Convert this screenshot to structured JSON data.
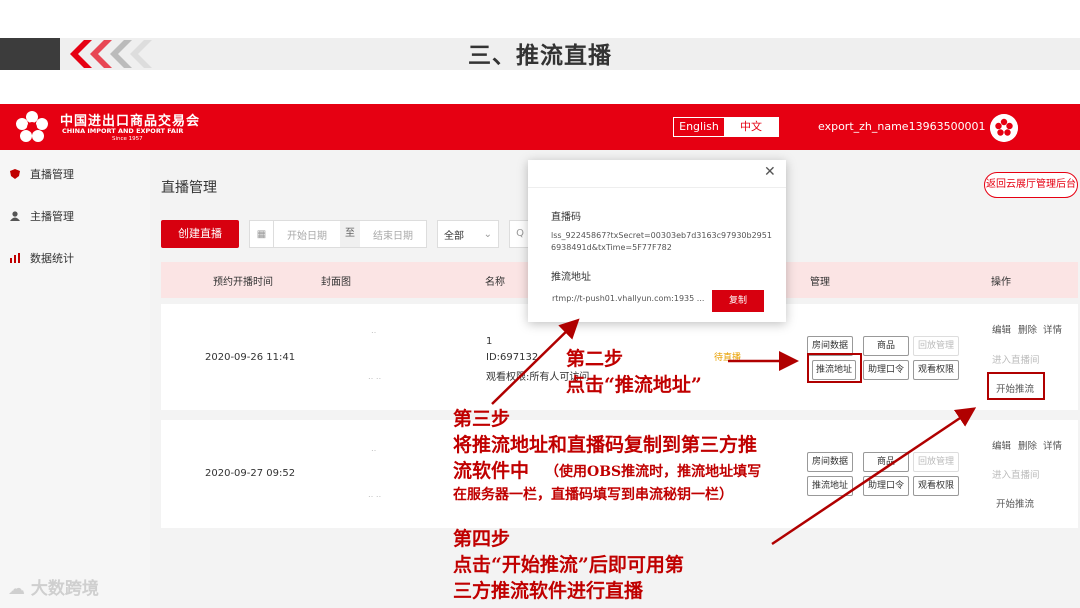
{
  "slide": {
    "title": "三、推流直播"
  },
  "header": {
    "logo_cn": "中国进出口商品交易会",
    "logo_en": "CHINA IMPORT AND EXPORT FAIR",
    "logo_since": "Since 1957",
    "lang_en": "English",
    "lang_zh": "中文",
    "username": "export_zh_name13963500001"
  },
  "sidebar": {
    "items": [
      {
        "label": "直播管理",
        "icon": "shield-icon"
      },
      {
        "label": "主播管理",
        "icon": "person-icon"
      },
      {
        "label": "数据统计",
        "icon": "bar-chart-icon"
      }
    ]
  },
  "main": {
    "heading": "直播管理",
    "back_button": "返回云展厅管理后台",
    "create_button": "创建直播",
    "start_date_placeholder": "开始日期",
    "range_to": "至",
    "end_date_placeholder": "结束日期",
    "filter_selected": "全部",
    "columns": [
      "预约开播时间",
      "封面图",
      "名称",
      "管理",
      "操作"
    ],
    "rows": [
      {
        "time": "2020-09-26 11:41",
        "name": "1",
        "id": "ID:697132",
        "permission": "观看权限:所有人可访问",
        "status": "待直播",
        "manage_buttons": [
          "房间数据",
          "商品",
          "回放管理",
          "推流地址",
          "助理口令",
          "观看权限"
        ],
        "ops": [
          "编辑",
          "删除",
          "详情",
          "进入直播间",
          "开始推流"
        ]
      },
      {
        "time": "2020-09-27 09:52",
        "manage_buttons": [
          "房间数据",
          "商品",
          "回放管理",
          "推流地址",
          "助理口令",
          "观看权限"
        ],
        "ops": [
          "编辑",
          "删除",
          "详情",
          "进入直播间",
          "开始推流"
        ]
      }
    ]
  },
  "modal": {
    "code_label": "直播码",
    "code_value": "lss_92245867?txSecret=00303eb7d3163c97930b29516938491d&txTime=5F77F782",
    "url_label": "推流地址",
    "url_value": "rtmp://t-push01.vhallyun.com:1935 ...",
    "copy_button": "复制"
  },
  "annotations": {
    "step2_title": "第二步",
    "step2_text": "点击“推流地址”",
    "step3_title": "第三步",
    "step3_line1": "将推流地址和直播码复制到第三方推",
    "step3_line2": "流软件中",
    "step3_line2_small": "（使用OBS推流时，推流地址填写",
    "step3_line3": "在服务器一栏，直播码填写到串流秘钥一栏）",
    "step4_title": "第四步",
    "step4_line1": "点击“开始推流”后即可用第",
    "step4_line2": "三方推流软件进行直播"
  },
  "watermark": "大数跨境",
  "colors": {
    "brand_red": "#e60012",
    "annotation_red": "#c00000",
    "header_pink": "#fbe4e4"
  }
}
